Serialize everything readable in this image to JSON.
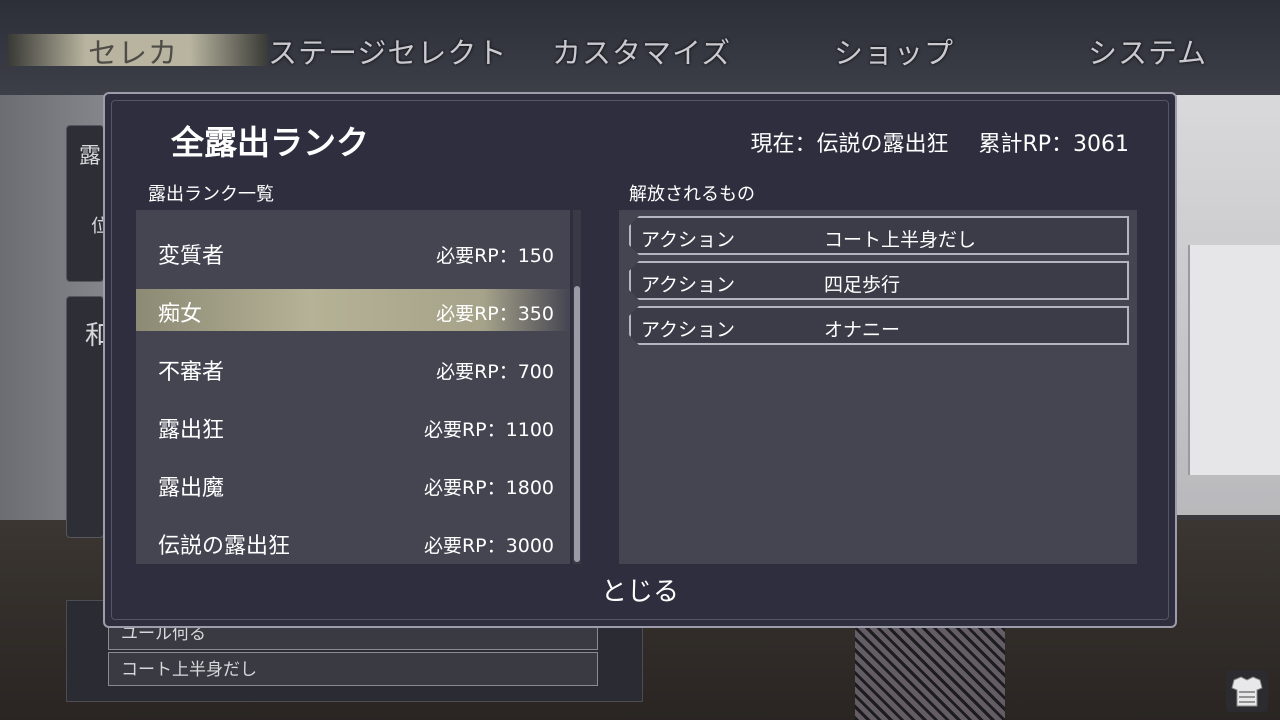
{
  "top_menu": {
    "tabs": [
      {
        "label": "セレカ",
        "active": true
      },
      {
        "label": "ステージセレクト",
        "active": false
      },
      {
        "label": "カスタマイズ",
        "active": false
      },
      {
        "label": "ショップ",
        "active": false
      },
      {
        "label": "システム",
        "active": false
      }
    ]
  },
  "background": {
    "partial_labels": [
      "露",
      "位",
      "和"
    ],
    "list_items": [
      "ユール何る",
      "コート上半身だし"
    ]
  },
  "dialog": {
    "title": "全露出ランク",
    "current_label": "現在：伝説の露出狂",
    "total_rp_label": "累計RP：3061",
    "rank_list_label": "露出ランク一覧",
    "unlock_label": "解放されるもの",
    "close_label": "とじる",
    "ranks": [
      {
        "name": "変質者",
        "required": "必要RP：150",
        "selected": false
      },
      {
        "name": "痴女",
        "required": "必要RP：350",
        "selected": true
      },
      {
        "name": "不審者",
        "required": "必要RP：700",
        "selected": false
      },
      {
        "name": "露出狂",
        "required": "必要RP：1100",
        "selected": false
      },
      {
        "name": "露出魔",
        "required": "必要RP：1800",
        "selected": false
      },
      {
        "name": "伝説の露出狂",
        "required": "必要RP：3000",
        "selected": false
      }
    ],
    "unlocks": [
      {
        "type": "アクション",
        "name": "コート上半身だし"
      },
      {
        "type": "アクション",
        "name": "四足歩行"
      },
      {
        "type": "アクション",
        "name": "オナニー"
      }
    ]
  },
  "icons": {
    "corner": "armor-icon"
  },
  "colors": {
    "dialog_bg": "#2e2e3f",
    "list_bg": "#454552",
    "selected_highlight": "#b5b296",
    "border": "#9c9cab"
  }
}
